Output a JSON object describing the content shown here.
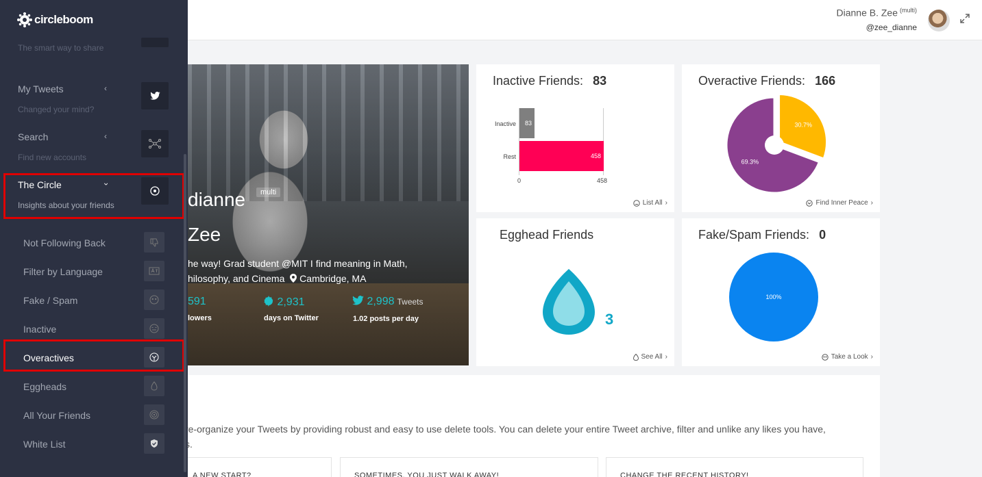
{
  "header": {
    "user_name": "Dianne B. Zee",
    "user_tag": "(multi)",
    "user_handle": "@zee_dianne"
  },
  "sidebar": {
    "logo_text": "circleboom",
    "tagline": "The smart way to share",
    "sections": [
      {
        "title": "My Tweets",
        "subtitle": "Changed your mind?",
        "icon": "twitter-icon"
      },
      {
        "title": "Search",
        "subtitle": "Find new accounts",
        "icon": "network-icon"
      },
      {
        "title": "The Circle",
        "subtitle": "Insights about your friends",
        "icon": "circle-target-icon"
      }
    ],
    "circle_items": [
      {
        "label": "Not Following Back",
        "icon": "thumbs-down-icon"
      },
      {
        "label": "Filter by Language",
        "icon": "language-icon"
      },
      {
        "label": "Fake / Spam",
        "icon": "mask-icon"
      },
      {
        "label": "Inactive",
        "icon": "sleepy-face-icon"
      },
      {
        "label": "Overactives",
        "icon": "overactive-icon"
      },
      {
        "label": "Eggheads",
        "icon": "egg-icon"
      },
      {
        "label": "All Your Friends",
        "icon": "concentric-circles-icon"
      },
      {
        "label": "White List",
        "icon": "shield-check-icon"
      }
    ]
  },
  "profile": {
    "name_line1": "dianne",
    "name_line2": "Zee",
    "badge": "multi",
    "bio_line1": "he way! Grad student @MIT I find meaning in Math,",
    "bio_line2": "hilosophy, and Cinema",
    "location": "Cambridge, MA",
    "followers_value": "591",
    "followers_label": "lowers",
    "days_value": "2,931",
    "days_label": "days on Twitter",
    "tweets_value": "2,998",
    "tweets_suffix": "Tweets",
    "tweets_label": "1.02 posts per day"
  },
  "widgets": {
    "inactive": {
      "title": "Inactive Friends:",
      "count": "83",
      "link": "List All"
    },
    "overactive": {
      "title": "Overactive Friends:",
      "count": "166",
      "link": "Find Inner Peace"
    },
    "egghead": {
      "title": "Egghead Friends",
      "count": "3",
      "link": "See All"
    },
    "fake": {
      "title": "Fake/Spam Friends:",
      "count": "0",
      "link": "Take a Look"
    }
  },
  "chart_data": [
    {
      "type": "bar",
      "orientation": "horizontal",
      "categories": [
        "Inactive",
        "Rest"
      ],
      "values": [
        83,
        458
      ],
      "colors": [
        "#7f7f7f",
        "#ff0055"
      ],
      "xlim": [
        0,
        458
      ],
      "x_ticks": [
        "0",
        "458"
      ]
    },
    {
      "type": "pie",
      "labels": [
        "30.7%",
        "69.3%"
      ],
      "values": [
        30.7,
        69.3
      ],
      "colors": [
        "#ffb800",
        "#8a3f8e"
      ]
    },
    {
      "type": "pie",
      "labels": [
        "100%"
      ],
      "values": [
        100
      ],
      "colors": [
        "#0a84f0"
      ]
    }
  ],
  "bottom": {
    "text_line1": "re-organize your Tweets by providing robust and easy to use delete tools. You can delete your entire Tweet archive, filter and unlike any likes you have,",
    "text_line2": "s.",
    "cards": [
      "A NEW START?",
      "SOMETIMES, YOU JUST WALK AWAY!",
      "CHANGE THE RECENT HISTORY!"
    ]
  }
}
